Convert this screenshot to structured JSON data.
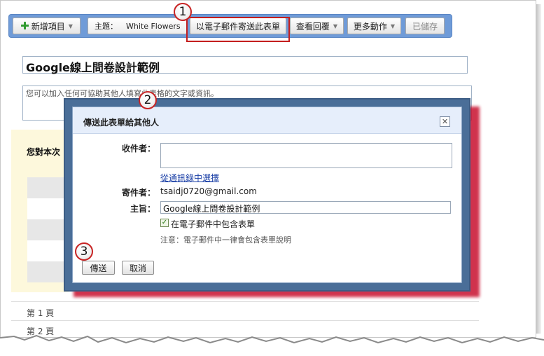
{
  "toolbar": {
    "new_item_label": "新增項目",
    "theme_label": "主題：",
    "theme_value": "White Flowers",
    "email_form_label": "以電子郵件寄送此表單",
    "view_responses_label": "查看回覆",
    "more_actions_label": "更多動作",
    "saved_label": "已儲存"
  },
  "form": {
    "title": "Google線上問卷設計範例",
    "description": "您可以加入任何可協助其他人填寫此表格的文字或資訊。",
    "question_label": "您對本次",
    "page1_label": "第 1 頁",
    "page2_label": "第 2 頁"
  },
  "dialog": {
    "title": "傳送此表單給其他人",
    "close_symbol": "✕",
    "recipients_label": "收件者：",
    "recipients_value": "",
    "contacts_link": "從通訊錄中選擇",
    "sender_label": "寄件者：",
    "sender_value": "tsaidj0720@gmail.com",
    "subject_label": "主旨：",
    "subject_value": "Google線上問卷設計範例",
    "include_form_checked": true,
    "include_form_label": "在電子郵件中包含表單",
    "note": "注意：電子郵件中一律會包含表單說明",
    "send_label": "傳送",
    "cancel_label": "取消"
  },
  "callouts": [
    "1",
    "2",
    "3"
  ],
  "colors": {
    "toolbar_blue": "#6f9bd8",
    "dialog_frame": "#4a6e98",
    "highlight_red": "#c41e1e",
    "link_blue": "#1a3fa6"
  },
  "icons": {
    "add": "plus-icon",
    "dropdown": "chevron-down-icon",
    "close": "close-icon",
    "check": "checkmark-icon"
  }
}
